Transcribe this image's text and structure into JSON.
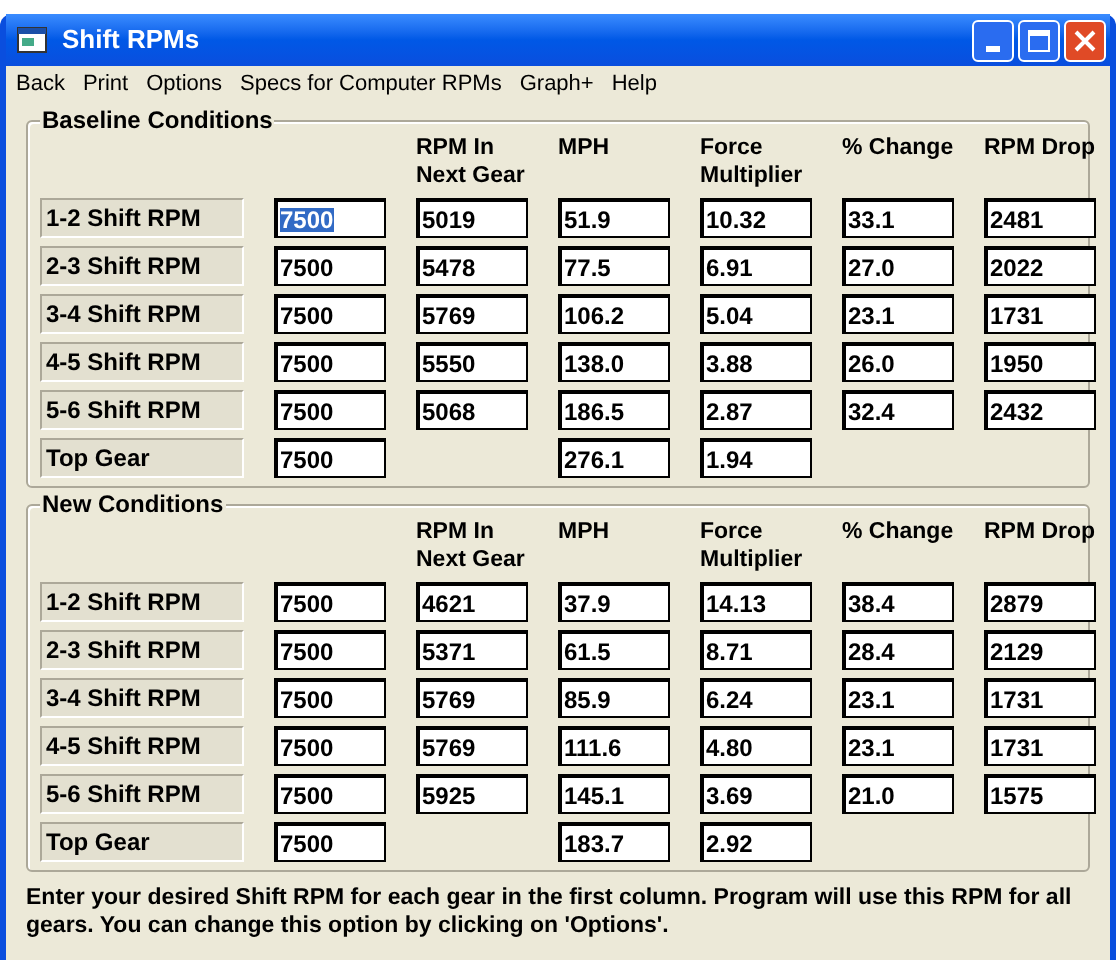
{
  "window": {
    "title": "Shift RPMs"
  },
  "menu": [
    "Back",
    "Print",
    "Options",
    "Specs for Computer RPMs",
    "Graph+",
    "Help"
  ],
  "sections": [
    {
      "title": "Baseline Conditions",
      "columns": [
        "RPM In\nNext Gear",
        "MPH",
        "Force\nMultiplier",
        "% Change",
        "RPM Drop"
      ],
      "rows": [
        {
          "label": "1-2 Shift RPM",
          "shift_rpm": {
            "value": "7500",
            "selected": true
          },
          "rpm_next_gear": "5019",
          "mph": "51.9",
          "force_multiplier": "10.32",
          "pct_change": "33.1",
          "rpm_drop": "2481"
        },
        {
          "label": "2-3 Shift RPM",
          "shift_rpm": {
            "value": "7500",
            "selected": false
          },
          "rpm_next_gear": "5478",
          "mph": "77.5",
          "force_multiplier": "6.91",
          "pct_change": "27.0",
          "rpm_drop": "2022"
        },
        {
          "label": "3-4 Shift RPM",
          "shift_rpm": {
            "value": "7500",
            "selected": false
          },
          "rpm_next_gear": "5769",
          "mph": "106.2",
          "force_multiplier": "5.04",
          "pct_change": "23.1",
          "rpm_drop": "1731"
        },
        {
          "label": "4-5 Shift RPM",
          "shift_rpm": {
            "value": "7500",
            "selected": false
          },
          "rpm_next_gear": "5550",
          "mph": "138.0",
          "force_multiplier": "3.88",
          "pct_change": "26.0",
          "rpm_drop": "1950"
        },
        {
          "label": "5-6 Shift RPM",
          "shift_rpm": {
            "value": "7500",
            "selected": false
          },
          "rpm_next_gear": "5068",
          "mph": "186.5",
          "force_multiplier": "2.87",
          "pct_change": "32.4",
          "rpm_drop": "2432"
        },
        {
          "label": "Top Gear",
          "shift_rpm": {
            "value": "7500",
            "selected": false
          },
          "mph": "276.1",
          "force_multiplier": "1.94"
        }
      ]
    },
    {
      "title": "New Conditions",
      "columns": [
        "RPM In\nNext Gear",
        "MPH",
        "Force\nMultiplier",
        "% Change",
        "RPM Drop"
      ],
      "rows": [
        {
          "label": "1-2 Shift RPM",
          "shift_rpm": {
            "value": "7500",
            "selected": false
          },
          "rpm_next_gear": "4621",
          "mph": "37.9",
          "force_multiplier": "14.13",
          "pct_change": "38.4",
          "rpm_drop": "2879"
        },
        {
          "label": "2-3 Shift RPM",
          "shift_rpm": {
            "value": "7500",
            "selected": false
          },
          "rpm_next_gear": "5371",
          "mph": "61.5",
          "force_multiplier": "8.71",
          "pct_change": "28.4",
          "rpm_drop": "2129"
        },
        {
          "label": "3-4 Shift RPM",
          "shift_rpm": {
            "value": "7500",
            "selected": false
          },
          "rpm_next_gear": "5769",
          "mph": "85.9",
          "force_multiplier": "6.24",
          "pct_change": "23.1",
          "rpm_drop": "1731"
        },
        {
          "label": "4-5 Shift RPM",
          "shift_rpm": {
            "value": "7500",
            "selected": false
          },
          "rpm_next_gear": "5769",
          "mph": "111.6",
          "force_multiplier": "4.80",
          "pct_change": "23.1",
          "rpm_drop": "1731"
        },
        {
          "label": "5-6 Shift RPM",
          "shift_rpm": {
            "value": "7500",
            "selected": false
          },
          "rpm_next_gear": "5925",
          "mph": "145.1",
          "force_multiplier": "3.69",
          "pct_change": "21.0",
          "rpm_drop": "1575"
        },
        {
          "label": "Top Gear",
          "shift_rpm": {
            "value": "7500",
            "selected": false
          },
          "mph": "183.7",
          "force_multiplier": "2.92"
        }
      ]
    }
  ],
  "footer": "Enter your desired Shift RPM for each gear in the first column.  Program will use this RPM for all gears.  You can change this option by clicking on 'Options'."
}
